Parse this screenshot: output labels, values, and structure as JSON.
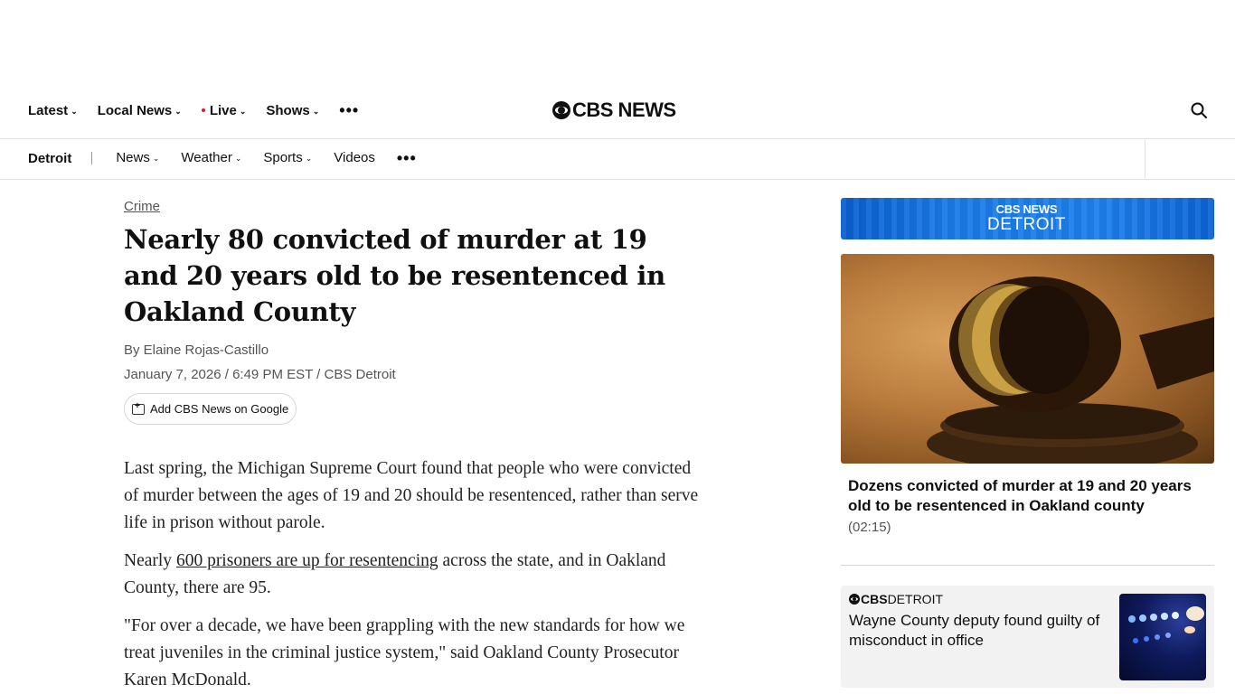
{
  "top_nav": {
    "items": [
      {
        "label": "Latest"
      },
      {
        "label": "Local News"
      },
      {
        "label": "Live"
      },
      {
        "label": "Shows"
      }
    ],
    "logo_text": "CBS NEWS"
  },
  "sub_nav": {
    "brand": "Detroit",
    "items": [
      {
        "label": "News"
      },
      {
        "label": "Weather"
      },
      {
        "label": "Sports"
      },
      {
        "label": "Videos"
      }
    ]
  },
  "article": {
    "category": "Crime",
    "headline": "Nearly 80 convicted of murder at 19 and 20 years old to be resentenced in Oakland County",
    "byline": "By Elaine Rojas-Castillo",
    "dateline": "January 7, 2026 / 6:49 PM EST / CBS Detroit",
    "google_button": "Add CBS News on Google",
    "para1": "Last spring, the Michigan Supreme Court found that people who were convicted of murder between the ages of 19 and 20 should be resentenced, rather than serve life in prison without parole.",
    "para2_before": "Nearly ",
    "para2_link": "600 prisoners are up for resentencing",
    "para2_after": " across the state, and in Oakland County, there are 95.",
    "para3": "\"For over a decade, we have been grappling with the new standards for how we treat juveniles in the criminal justice system,\" said Oakland County Prosecutor Karen McDonald."
  },
  "sidebar": {
    "banner_top": "CBS NEWS",
    "banner_bottom": "DETROIT",
    "video": {
      "title": "Dozens convicted of murder at 19 and 20 years old to be resentenced in Oakland county",
      "duration": "(02:15)"
    },
    "story": {
      "brand_bold": "CBS",
      "brand_rest": " DETROIT",
      "title": "Wayne County deputy found guilty of misconduct in office"
    }
  },
  "colors": {
    "text": "#101010",
    "live_dot": "#e5142c",
    "banner_blue": "#1a7be8",
    "card_bg": "#f2f2f2"
  },
  "icons": [
    "chevron-down-icon",
    "more-icon",
    "search-icon",
    "google-add-icon",
    "cbs-eye-logo-icon"
  ]
}
